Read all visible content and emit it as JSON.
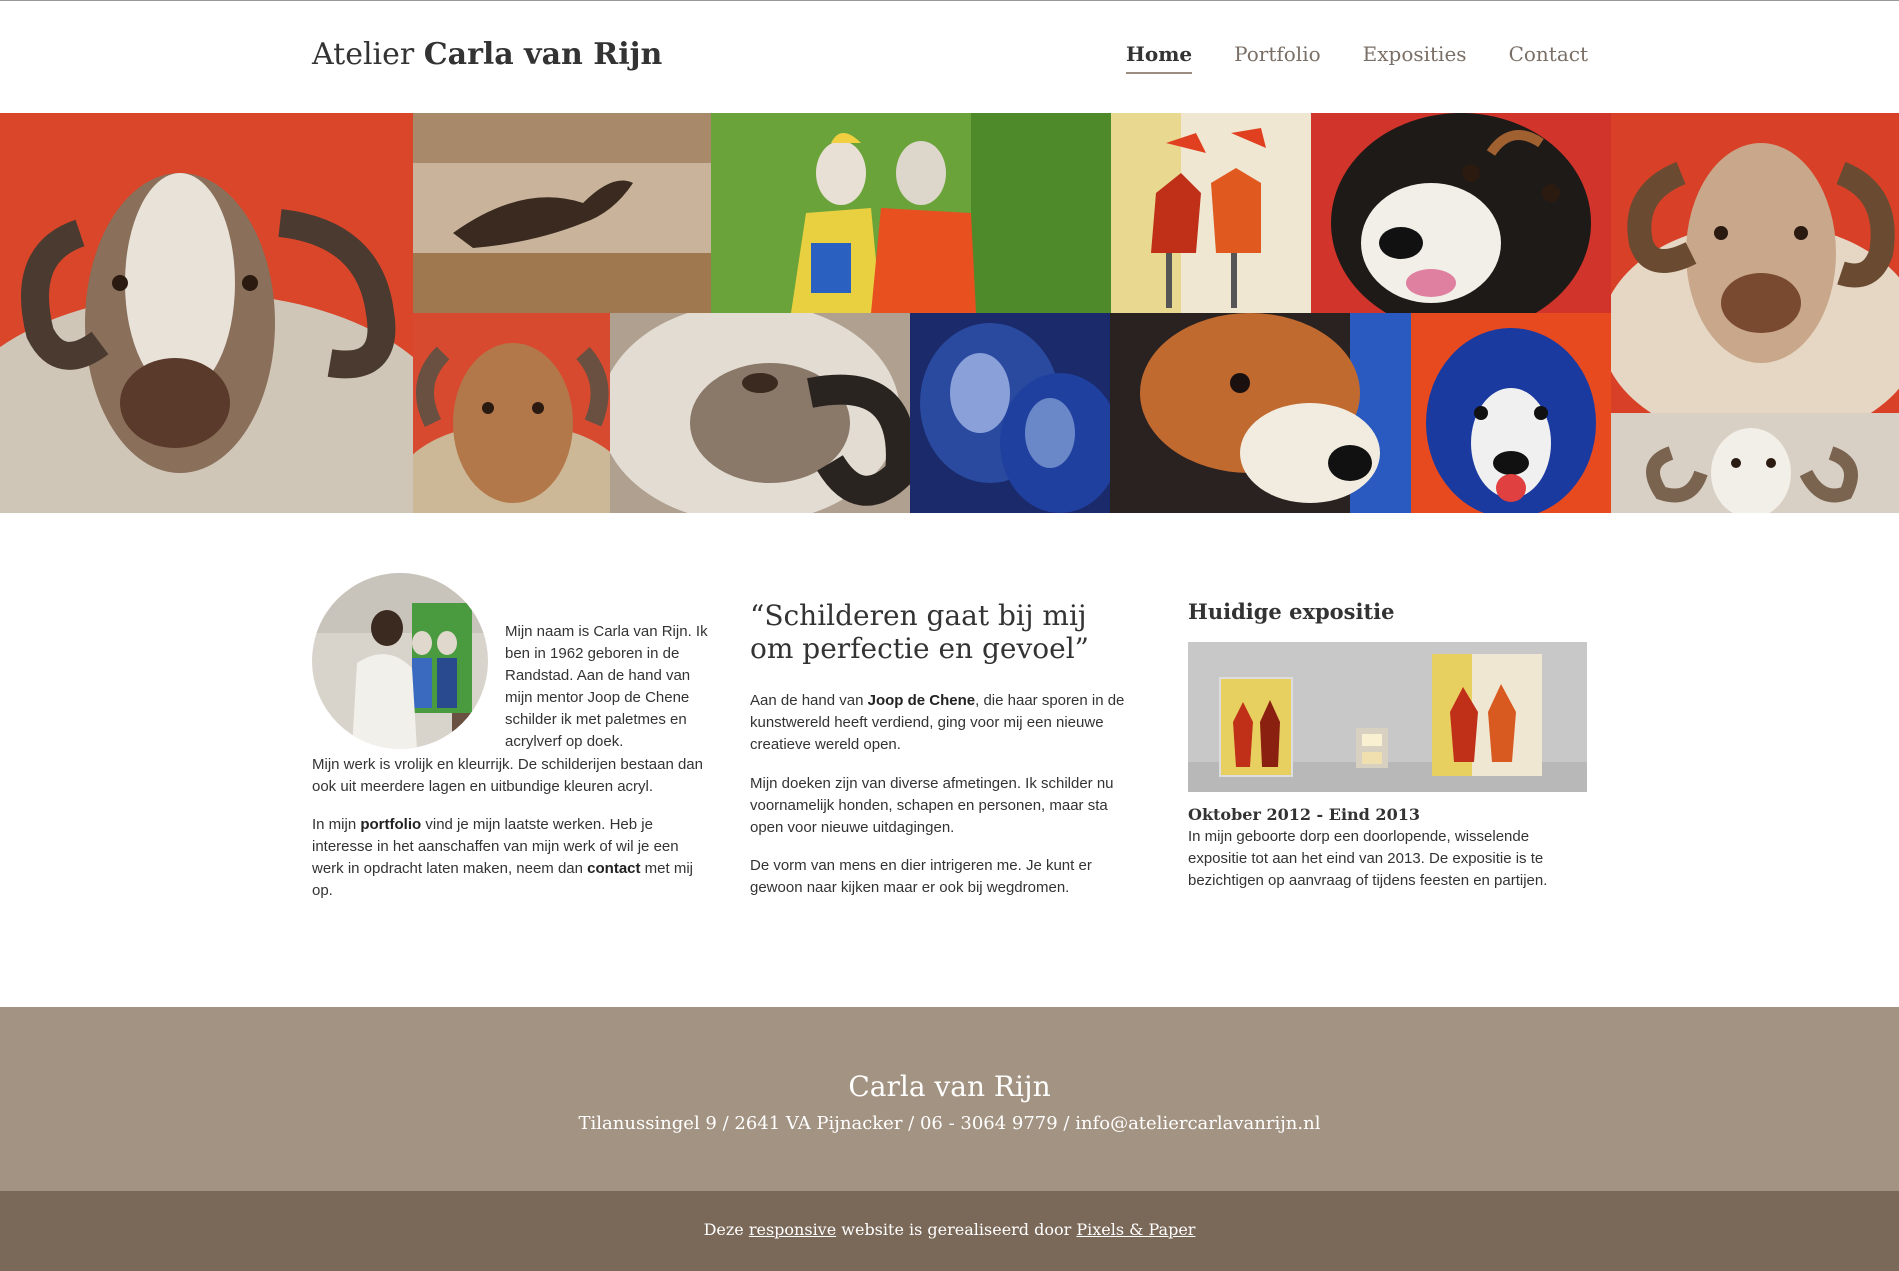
{
  "header": {
    "logo_regular": "Atelier",
    "logo_bold": "Carla van Rijn",
    "nav": [
      {
        "label": "Home",
        "active": true
      },
      {
        "label": "Portfolio",
        "active": false
      },
      {
        "label": "Exposities",
        "active": false
      },
      {
        "label": "Contact",
        "active": false
      }
    ]
  },
  "about": {
    "intro": "Mijn naam is Carla van Rijn. Ik ben in 1962 geboren in de Randstad. Aan de hand van mijn mentor Joop de Chene schilder ik met paletmes en acrylverf op doek.",
    "p1": "Mijn werk is vrolijk en kleurrijk. De schilderijen bestaan dan ook uit meerdere lagen en uitbundige kleuren acryl.",
    "p2_a": "In mijn ",
    "p2_link1": "portfolio",
    "p2_b": " vind je mijn laatste werken. Heb je interesse in het aanschaffen van mijn werk of wil je een werk in opdracht laten maken, neem dan ",
    "p2_link2": "contact",
    "p2_c": " met mij op."
  },
  "quote_section": {
    "quote": "“Schilderen gaat bij mij om perfectie en gevoel”",
    "p1_a": "Aan de hand van ",
    "p1_bold": "Joop de Chene",
    "p1_b": ", die haar sporen in de kunstwereld heeft verdiend, ging voor mij een nieuwe creatieve wereld open.",
    "p2": "Mijn doeken zijn van diverse afmetingen. Ik schilder nu voornamelijk honden, schapen en personen, maar sta open voor nieuwe uitdagingen.",
    "p3": "De vorm van mens en dier intrigeren me. Je kunt er gewoon naar kijken maar er ook bij wegdromen."
  },
  "exhibition": {
    "title": "Huidige expositie",
    "date": "Oktober 2012 - Eind 2013",
    "text": "In mijn geboorte dorp een doorlopende, wisselende expositie tot aan het eind van 2013. De expositie is te bezichtigen op aanvraag of tijdens feesten en partijen."
  },
  "footer": {
    "name": "Carla van Rijn",
    "address": "Tilanussingel 9 / 2641 VA Pijnacker / 06 - 3064 9779 / info@ateliercarlavanrijn.nl",
    "credit_a": "Deze ",
    "credit_link1": "responsive",
    "credit_b": " website is gerealiseerd door ",
    "credit_link2": "Pixels & Paper"
  },
  "colors": {
    "footer_top": "#a39382",
    "footer_bottom": "#7a6858",
    "nav_active_underline": "#9a8c7e"
  }
}
